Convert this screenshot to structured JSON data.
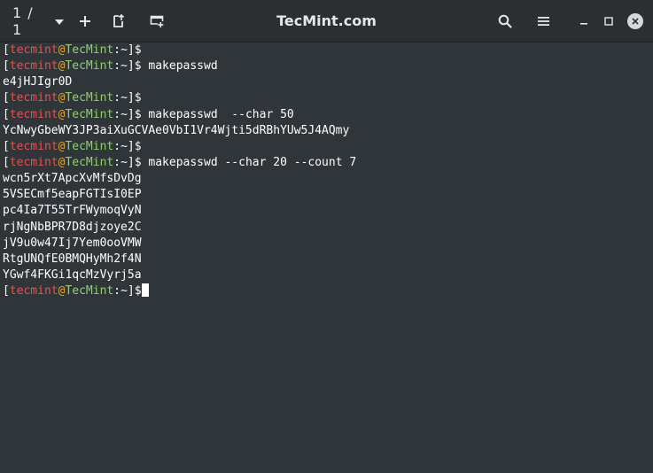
{
  "titlebar": {
    "tab_counter": "1 / 1",
    "title": "TecMint.com",
    "icons": [
      "chevron-down-icon",
      "new-tab-icon",
      "detach-tab-icon",
      "add-terminal-icon",
      "search-icon",
      "hamburger-menu-icon",
      "minimize-icon",
      "maximize-icon",
      "close-icon"
    ]
  },
  "prompt": {
    "open_bracket": "[",
    "user": "tecmint",
    "at": "@",
    "host": "TecMint",
    "path": ":~",
    "close_bracket": "]",
    "symbol": "$"
  },
  "colors": {
    "background": "#2f3539",
    "titlebar": "#2b2f32",
    "user": "#e35353",
    "at": "#e5a52e",
    "host": "#8ed16b",
    "text": "#ffffff"
  },
  "lines": [
    {
      "type": "prompt",
      "cmd": ""
    },
    {
      "type": "prompt",
      "cmd": " makepasswd"
    },
    {
      "type": "output",
      "text": "e4jHJIgr0D"
    },
    {
      "type": "prompt",
      "cmd": ""
    },
    {
      "type": "prompt",
      "cmd": " makepasswd  --char 50"
    },
    {
      "type": "output",
      "text": "YcNwyGbeWY3JP3aiXuGCVAe0VbI1Vr4Wjti5dRBhYUw5J4AQmy"
    },
    {
      "type": "prompt",
      "cmd": ""
    },
    {
      "type": "prompt",
      "cmd": " makepasswd --char 20 --count 7"
    },
    {
      "type": "output",
      "text": "wcn5rXt7ApcXvMfsDvDg"
    },
    {
      "type": "output",
      "text": "5VSECmf5eapFGTIsI0EP"
    },
    {
      "type": "output",
      "text": "pc4Ia7T55TrFWymoqVyN"
    },
    {
      "type": "output",
      "text": "rjNgNbBPR7D8djzoye2C"
    },
    {
      "type": "output",
      "text": "jV9u0w47Ij7Yem0ooVMW"
    },
    {
      "type": "output",
      "text": "RtgUNQfE0BMQHyMh2f4N"
    },
    {
      "type": "output",
      "text": "YGwf4FKGi1qcMzVyrj5a"
    },
    {
      "type": "prompt",
      "cmd": "",
      "cursor": true
    }
  ]
}
